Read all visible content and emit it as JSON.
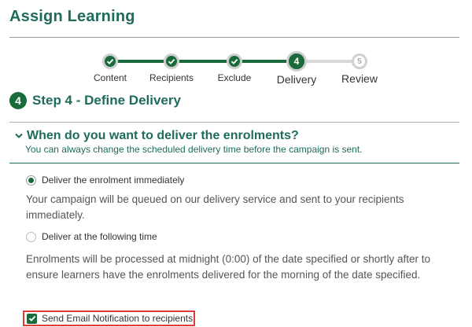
{
  "page": {
    "title": "Assign Learning"
  },
  "colors": {
    "brand_green": "#1a6b3c",
    "title_teal": "#1f6b5c",
    "highlight_red": "#e03b3b",
    "inactive_gray": "#d9d9d9"
  },
  "wizard": {
    "steps": [
      {
        "label": "Content",
        "state": "completed",
        "icon": "check-icon"
      },
      {
        "label": "Recipients",
        "state": "completed",
        "icon": "check-icon"
      },
      {
        "label": "Exclude",
        "state": "completed",
        "icon": "check-icon"
      },
      {
        "label": "Delivery",
        "state": "current",
        "number": "4"
      },
      {
        "label": "Review",
        "state": "upcoming",
        "number": "5"
      }
    ]
  },
  "step_heading": {
    "number": "4",
    "text": "Step 4 - Define Delivery"
  },
  "section": {
    "title": "When do you want to deliver the enrolments?",
    "subtitle": "You can always change the scheduled delivery time before the campaign is sent.",
    "expanded_icon": "chevron-down-icon"
  },
  "options": [
    {
      "label": "Deliver the enrolment immediately",
      "selected": true,
      "description": "Your campaign will be queued on our delivery service and sent to your recipients immediately."
    },
    {
      "label": "Deliver at the following time",
      "selected": false,
      "description": "Enrolments will be processed at midnight (0:00) of the date specified or shortly after to ensure learners have the enrolments delivered for the morning of the date specified."
    }
  ],
  "notification": {
    "label": "Send Email Notification to recipients",
    "checked": true
  }
}
